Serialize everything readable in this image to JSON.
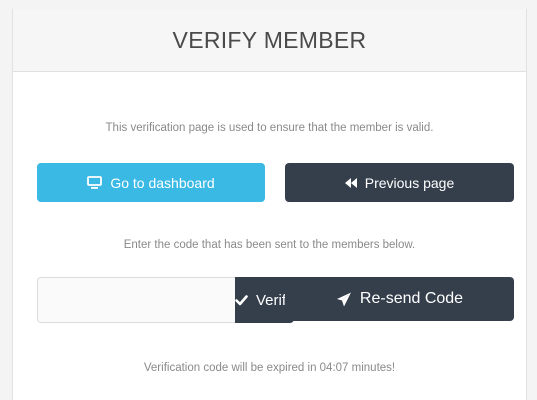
{
  "panel": {
    "title": "VERIFY MEMBER"
  },
  "intro_text": "This verification page is used to ensure that the member is valid.",
  "buttons": {
    "dashboard_label": "Go to dashboard",
    "dashboard_icon": "monitor-icon",
    "previous_label": "Previous page",
    "previous_icon": "backward-icon",
    "verify_label": "Verify",
    "verify_icon": "check-icon",
    "resend_label": "Re-send Code",
    "resend_icon": "send-icon"
  },
  "instruction_text": "Enter the code that has been sent to the members below.",
  "code_input": {
    "value": "",
    "placeholder": ""
  },
  "expire_text": "Verification code will be expired in 04:07 minutes!",
  "colors": {
    "primary_blue": "#3bb9e5",
    "dark": "#353f4c"
  }
}
